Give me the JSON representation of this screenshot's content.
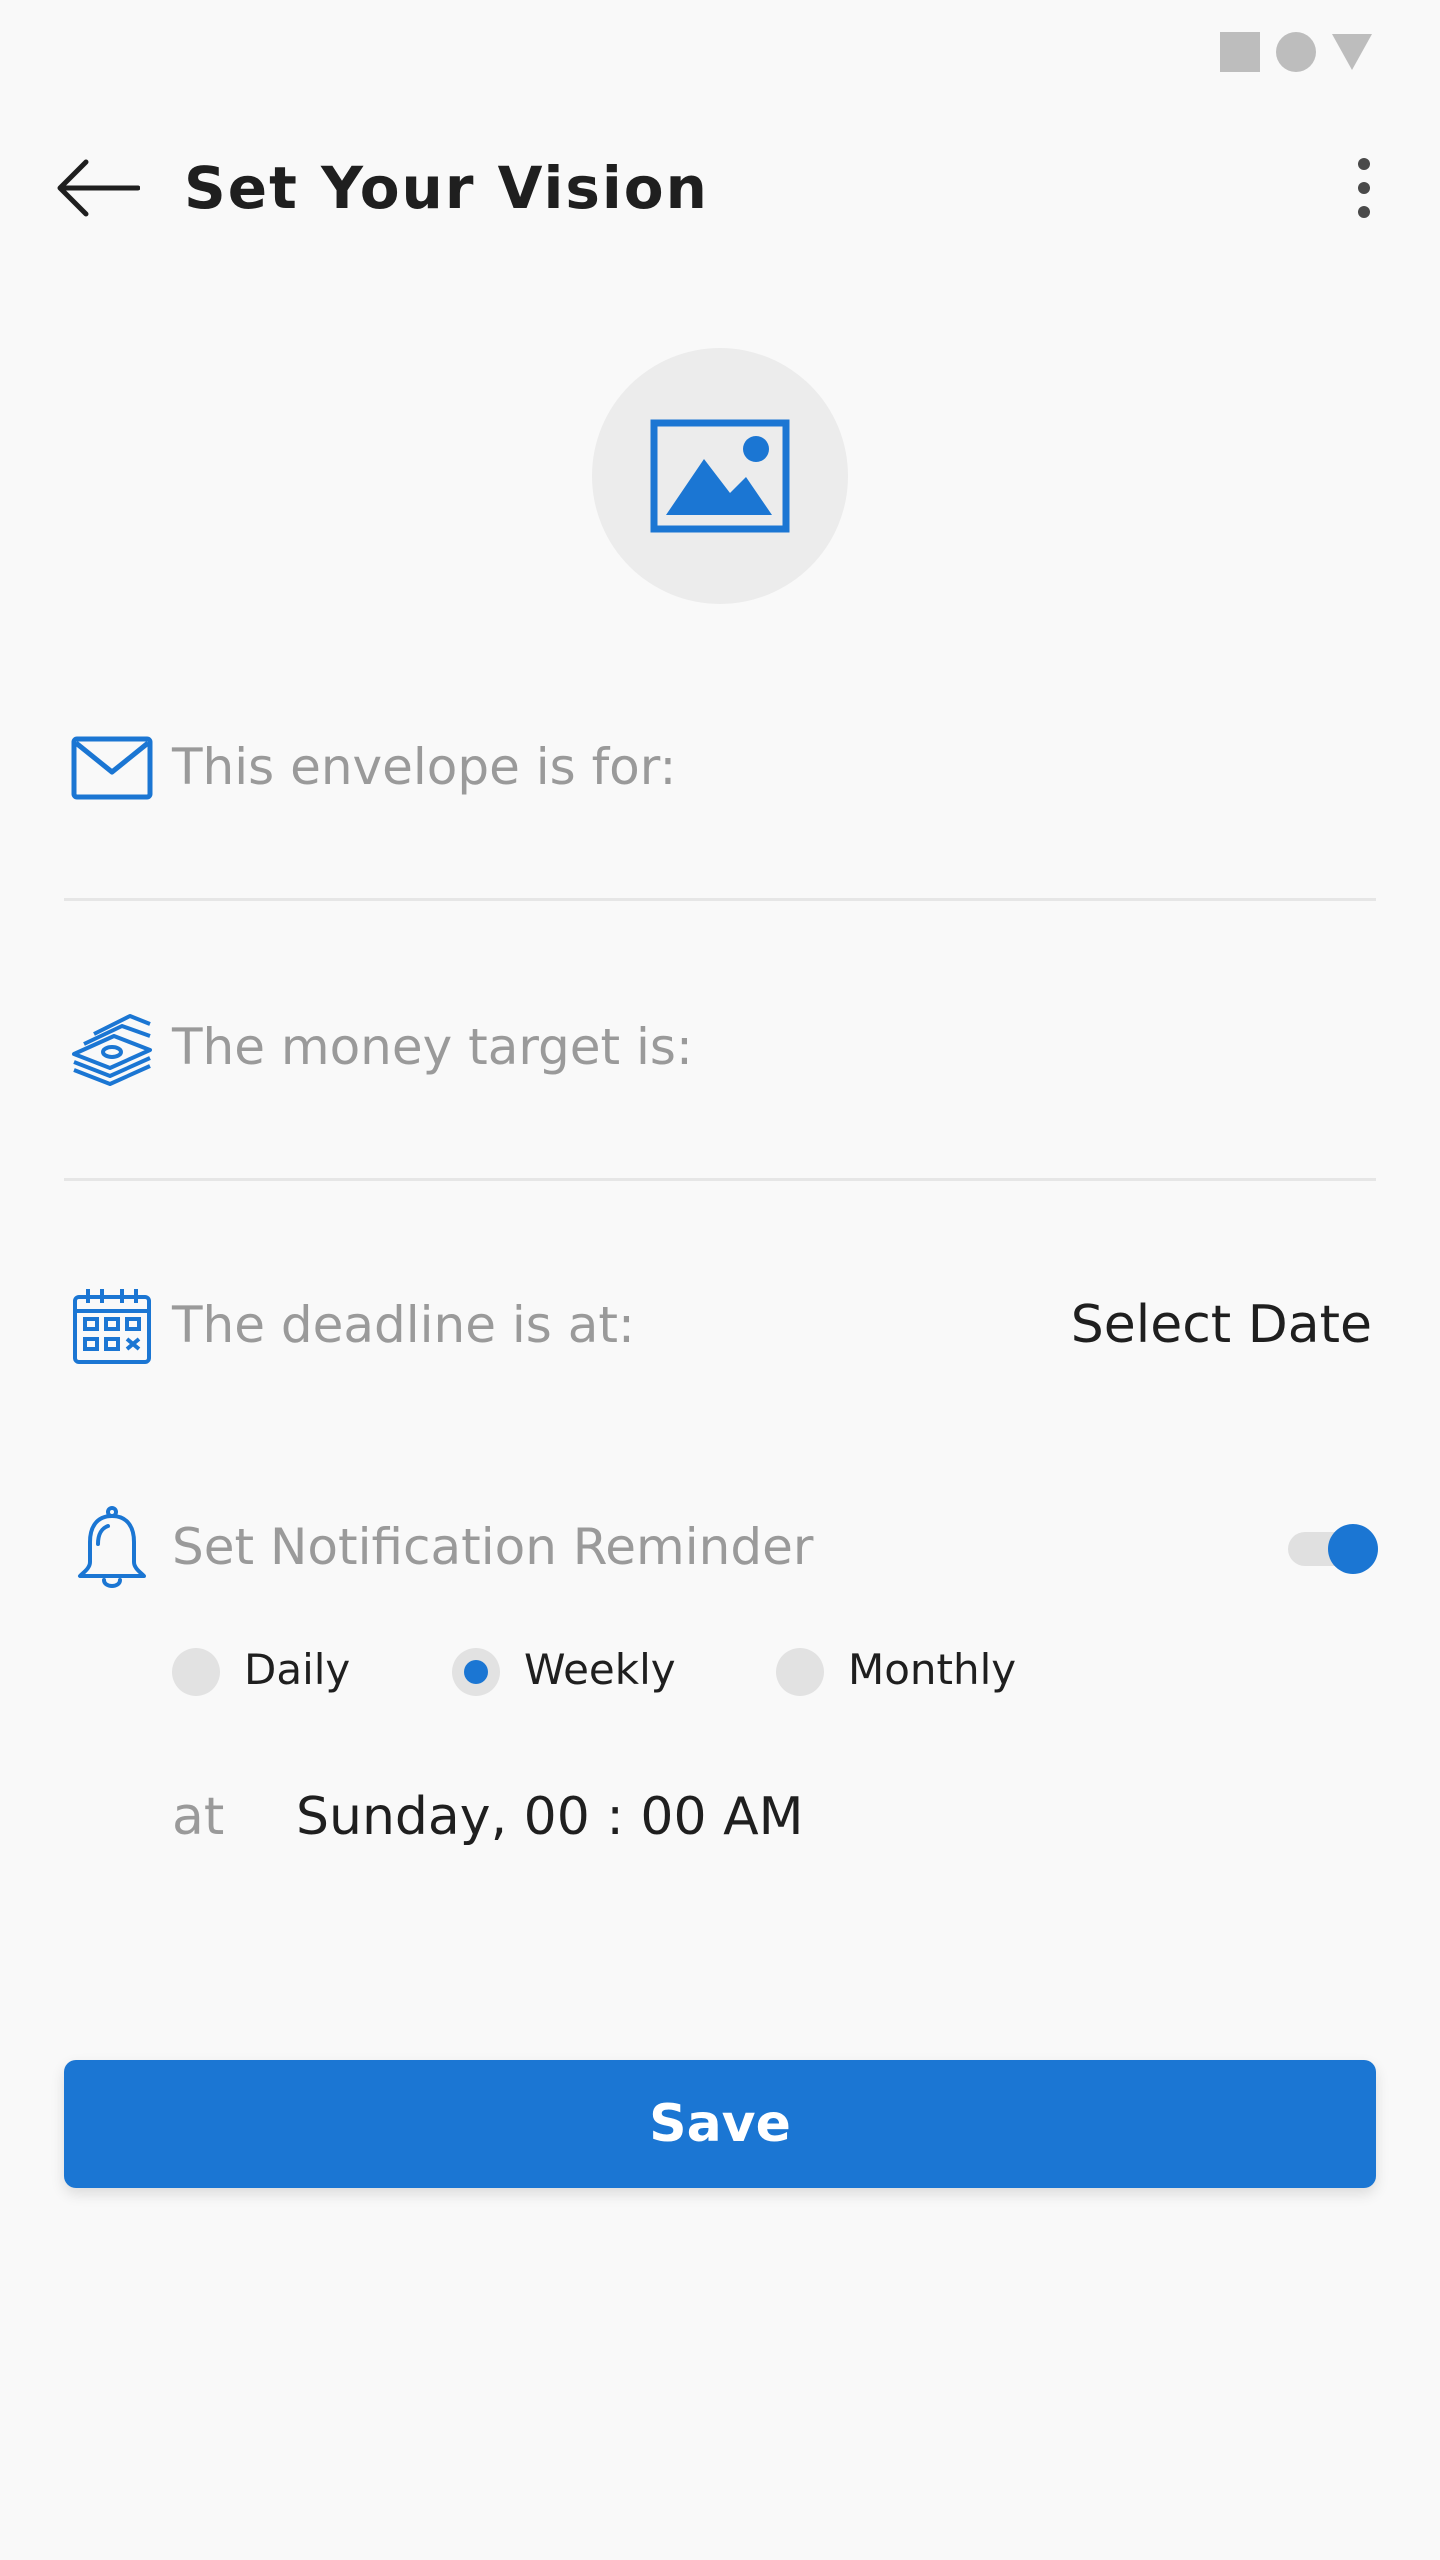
{
  "header": {
    "title": "Set Your Vision",
    "back_icon": "arrow-left-icon",
    "menu_icon": "more-vert-icon"
  },
  "image_picker": {
    "icon": "image-icon"
  },
  "form": {
    "envelope_label": "This envelope is for:",
    "envelope_icon": "envelope-icon",
    "money_label": "The money target is:",
    "money_icon": "money-stack-icon",
    "deadline_label": "The deadline is at:",
    "deadline_icon": "calendar-icon",
    "deadline_value": "Select Date",
    "reminder_label": "Set Notification Reminder",
    "reminder_icon": "bell-icon",
    "reminder_enabled": true
  },
  "frequency": {
    "options": [
      "Daily",
      "Weekly",
      "Monthly"
    ],
    "selected": "Weekly"
  },
  "schedule": {
    "at_label": "at",
    "value": "Sunday, 00 : 00 AM"
  },
  "save_label": "Save",
  "colors": {
    "accent": "#1b76d3",
    "background": "#f9f9f9",
    "muted_text": "#9a9a9a"
  }
}
